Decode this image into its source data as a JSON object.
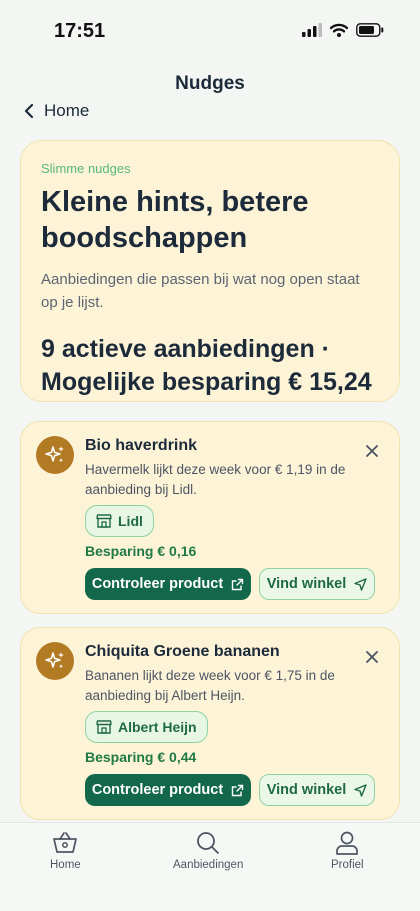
{
  "status": {
    "time": "17:51"
  },
  "nav": {
    "title": "Nudges",
    "back_label": "Home"
  },
  "hero": {
    "eyebrow": "Slimme nudges",
    "title": "Kleine hints, betere boodschappen",
    "description": "Aanbiedingen die passen bij wat nog open staat op je lijst.",
    "summary": "9 actieve aanbiedingen · Mogelijke besparing € 15,24"
  },
  "cards": [
    {
      "title": "Bio haverdrink",
      "body": "Havermelk lijkt deze week voor € 1,19 in de aanbieding bij Lidl.",
      "store": "Lidl",
      "saving": "Besparing € 0,16",
      "primary_label": "Controleer product",
      "secondary_label": "Vind winkel"
    },
    {
      "title": "Chiquita Groene bananen",
      "body": "Bananen lijkt deze week voor € 1,75 in de aanbieding bij Albert Heijn.",
      "store": "Albert Heijn",
      "saving": "Besparing € 0,44",
      "primary_label": "Controleer product",
      "secondary_label": "Vind winkel"
    }
  ],
  "tabbar": {
    "home": "Home",
    "offers": "Aanbiedingen",
    "profile": "Profiel"
  },
  "colors": {
    "accent": "#13674a",
    "card_bg": "#fdf4d8",
    "eyebrow": "#56b77e",
    "avatar": "#b37a24"
  },
  "icons": {
    "back": "chevron-left-icon",
    "card": "sparkles-icon",
    "store": "storefront-icon",
    "primary": "external-link-icon",
    "secondary": "navigation-arrow-icon",
    "close": "close-icon",
    "tab_home": "basket-icon",
    "tab_offers": "search-icon",
    "tab_profile": "person-icon"
  }
}
